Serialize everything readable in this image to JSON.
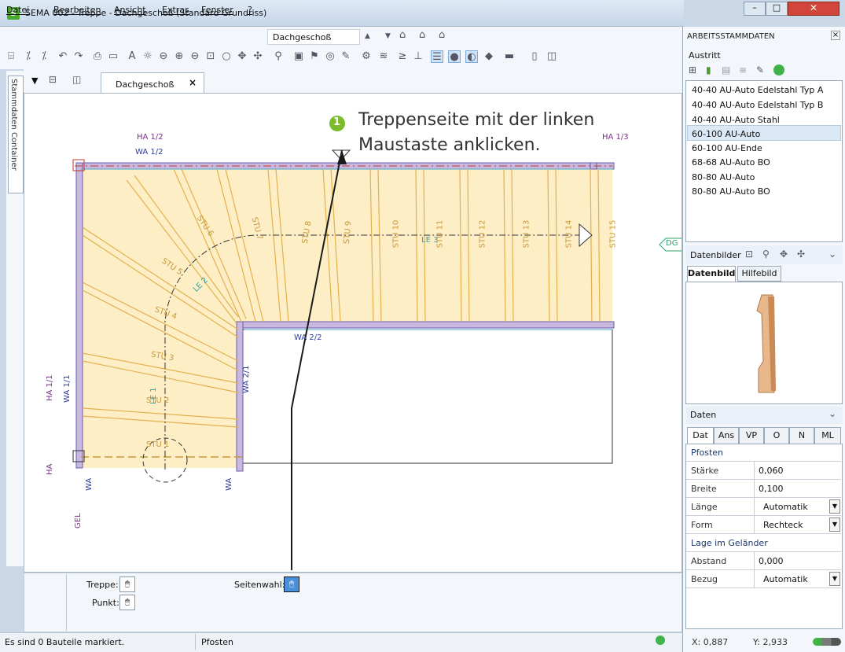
{
  "window": {
    "title": "SEMA  002 - Treppe  - Dachgeschoß (Standard Grundriss)",
    "app_icon_letter": "S"
  },
  "menu": [
    "Datei",
    "Bearbeiten",
    "Ansicht",
    "Extras",
    "Fenster",
    "?"
  ],
  "floor_select": {
    "value": "Dachgeschoß"
  },
  "side_tab": {
    "label": "Stammdaten Container"
  },
  "document_tab": {
    "label": "Dachgeschoß",
    "close": "×"
  },
  "plan_labels": {
    "ha_1_2": "HA 1/2",
    "wa_1_2": "WA 1/2",
    "ha_1_3": "HA 1/3",
    "wa_2_2": "WA 2/2",
    "wa_2_1": "WA 2/1",
    "ha_1_1": "HA 1/1",
    "wa_1_1": "WA 1/1",
    "ha": "HA",
    "wa_left": "WA",
    "wa_mid": "WA",
    "gel": "GEL",
    "le_1": "LE 1",
    "le_2": "LE 2",
    "le_3": "LE 3",
    "dg_tag": "DG",
    "steps": [
      "STU 1",
      "STU 2",
      "STU 3",
      "STU 4",
      "STU 5",
      "STU 6",
      "STU 7",
      "STU 8",
      "STU 9",
      "STU 10",
      "STU 11",
      "STU 12",
      "STU 13",
      "STU 14",
      "STU 15"
    ]
  },
  "callout": {
    "number": "1",
    "line1": "Treppenseite mit der linken",
    "line2": "Maustaste anklicken."
  },
  "bottom_panel": {
    "treppe_label": "Treppe:",
    "punkt_label": "Punkt:",
    "seitenwahl_label": "Seitenwahl:"
  },
  "status": {
    "message": "Es sind 0 Bauteile markiert.",
    "object": "Pfosten",
    "x": "X: 0,887",
    "y": "Y: 2,933"
  },
  "right_panel": {
    "title": "ARBEITSSTAMMDATEN",
    "tree_root": "Austritt",
    "items": [
      "40-40 AU-Auto Edelstahl Typ A",
      "40-40 AU-Auto Edelstahl Typ B",
      "40-40 AU-Auto Stahl",
      "60-100 AU-Auto",
      "60-100 AU-Ende",
      "68-68 AU-Auto BO",
      "80-80 AU-Auto",
      "80-80 AU-Auto BO"
    ],
    "selected_index": 3,
    "datenbilder": {
      "title": "Datenbilder",
      "tabs": [
        "Datenbild",
        "Hilfebild"
      ]
    },
    "daten": {
      "title": "Daten",
      "tabs": [
        "Dat",
        "Ans",
        "VP",
        "O",
        "N",
        "ML"
      ],
      "group1": "Pfosten",
      "rows1": [
        {
          "label": "Stärke",
          "value": "0,060"
        },
        {
          "label": "Breite",
          "value": "0,100"
        },
        {
          "label": "Länge",
          "value": "Automatik"
        },
        {
          "label": "Form",
          "value": "Rechteck"
        }
      ],
      "group2": "Lage im Geländer",
      "rows2": [
        {
          "label": "Abstand",
          "value": "0,000"
        },
        {
          "label": "Bezug",
          "value": "Automatik"
        }
      ]
    }
  },
  "colors": {
    "stair_fill": "#fdeec6",
    "stair_line": "#e2b04e",
    "wall": "#6c5ca8",
    "label_purple": "#7a2d8c",
    "label_blue": "#2b3d9e",
    "callout_green": "#7bbb2c",
    "dg_green": "#2aa36a"
  }
}
